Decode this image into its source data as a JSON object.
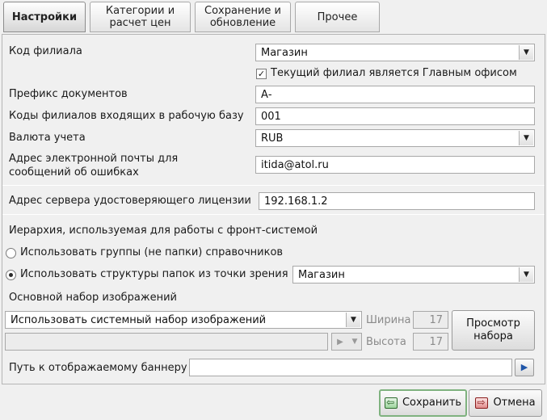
{
  "tabs": [
    {
      "label": "Настройки"
    },
    {
      "label": "Категории и расчет цен"
    },
    {
      "label": "Сохранение и обновление"
    },
    {
      "label": "Прочее"
    }
  ],
  "form": {
    "branch_code_label": "Код филиала",
    "branch_code_value": "Магазин",
    "main_office_label": "Текущий филиал является Главным офисом",
    "doc_prefix_label": "Префикс  документов",
    "doc_prefix_value": "А-",
    "incoming_codes_label": "Коды филиалов входящих в рабочую базу",
    "incoming_codes_value": "001",
    "currency_label": "Валюта учета",
    "currency_value": "RUB",
    "email_label_line1": "Адрес электронной почты для",
    "email_label_line2": "сообщений об ошибках",
    "email_value": "itida@atol.ru",
    "license_server_label": "Адрес сервера удостоверяющего лицензии",
    "license_server_value": "192.168.1.2",
    "hierarchy_label": "Иерархия, используемая для работы с фронт-системой",
    "radio_groups_label": "Использовать группы (не папки)  справочников",
    "radio_folders_label": "Использовать структуры папок из точки зрения",
    "folders_view_value": "Магазин",
    "image_set_label": "Основной набор изображений",
    "image_set_value": "Использовать системный набор изображений",
    "width_label": "Ширина",
    "width_value": "17",
    "height_label": "Высота",
    "height_value": "17",
    "preview_button_line1": "Просмотр",
    "preview_button_line2": "набора",
    "banner_path_label": "Путь к отображаемому баннеру",
    "banner_path_value": ""
  },
  "footer": {
    "save_label": "Сохранить",
    "cancel_label": "Отмена"
  },
  "icons": {
    "dropdown": "chevron-down-icon",
    "checkmark": "checkmark-icon",
    "browse": "play-arrow-icon",
    "save": "save-icon",
    "cancel": "cancel-icon"
  }
}
